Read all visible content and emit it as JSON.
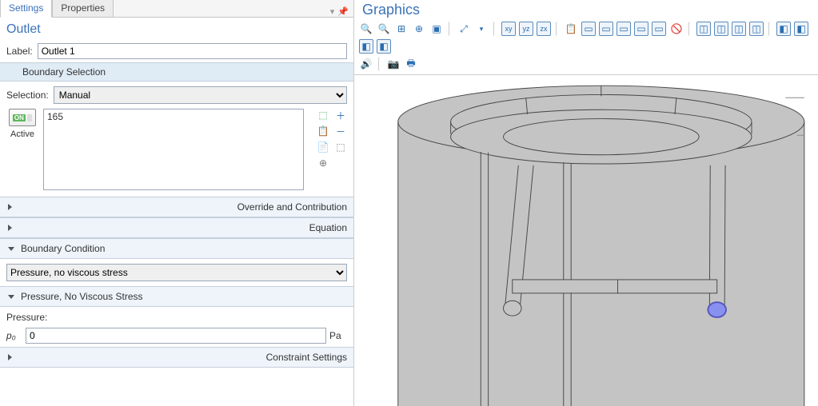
{
  "tabs": {
    "settings": "Settings",
    "properties": "Properties"
  },
  "title": "Outlet",
  "label_field": {
    "label": "Label:",
    "value": "Outlet 1"
  },
  "boundary_selection_header": "Boundary Selection",
  "selection": {
    "label": "Selection:",
    "value": "Manual"
  },
  "active_label": "Active",
  "selection_list": [
    "165"
  ],
  "expanders": {
    "override": "Override and Contribution",
    "equation": "Equation",
    "boundary_condition": "Boundary Condition",
    "pnvs": "Pressure, No Viscous Stress",
    "constraint": "Constraint Settings"
  },
  "bc_dropdown": "Pressure, no viscous stress",
  "pressure": {
    "label": "Pressure:",
    "symbol": "p₀",
    "value": "0",
    "unit": "Pa"
  },
  "graphics_title": "Graphics",
  "toolbar_row1": {
    "zoom_in": "🔍",
    "zoom_out": "🔍",
    "zoom_ext": "⊞",
    "zoom_sel": "⊕",
    "box": "▣",
    "axes": "⤢",
    "xy": "xy",
    "yz": "yz",
    "zx": "zx",
    "copy": "📋",
    "v1": "▭",
    "v2": "▭",
    "v3": "▭",
    "v4": "▭",
    "v5": "▭",
    "hide": "🚫",
    "sel1": "◫",
    "sel2": "◫",
    "sel3": "◫",
    "sel4": "◫",
    "t1": "◧",
    "t2": "◧",
    "t3": "◧",
    "t4": "◧"
  },
  "toolbar_row2": {
    "sound": "🔊",
    "cam": "📷",
    "print": "🖶"
  }
}
